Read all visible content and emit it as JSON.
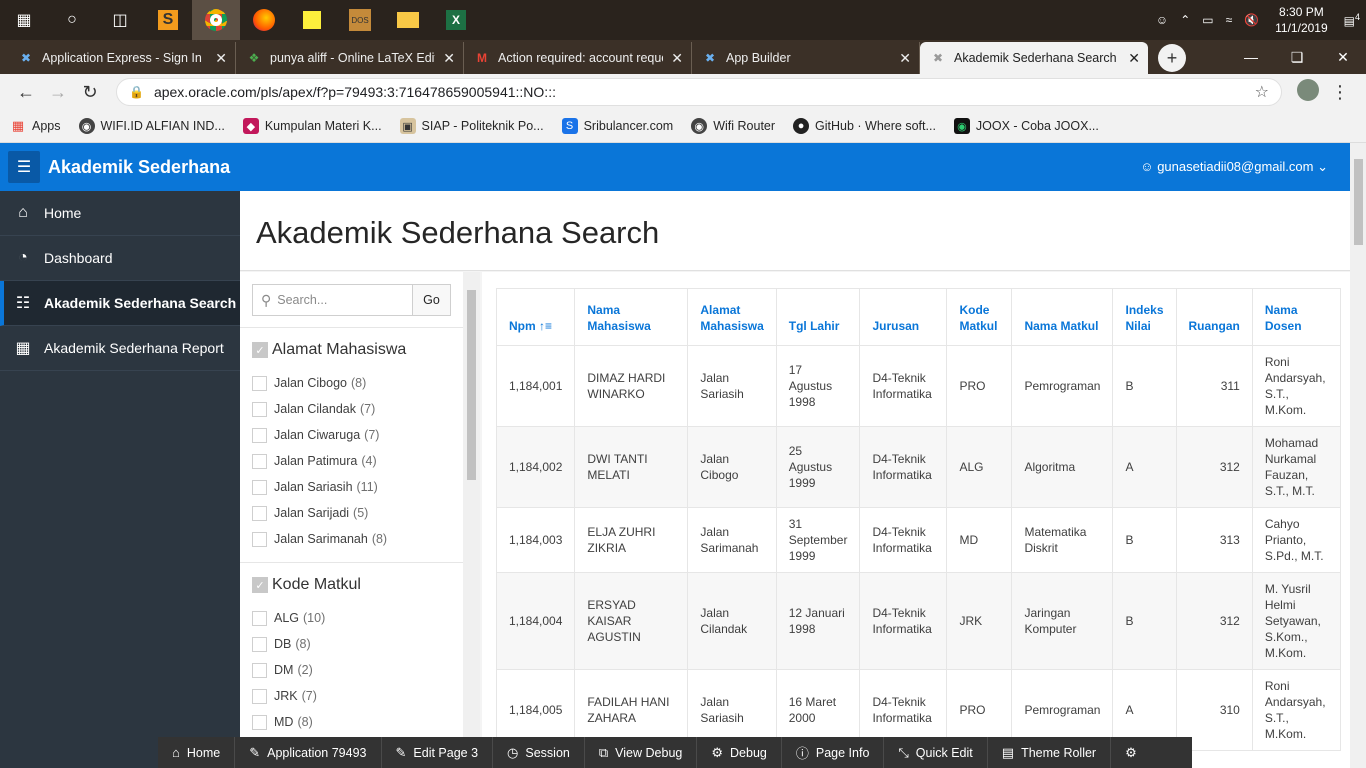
{
  "taskbar": {
    "time": "8:30 PM",
    "date": "11/1/2019",
    "notif_count": "4"
  },
  "browser": {
    "tabs": [
      {
        "title": "Application Express - Sign In",
        "icon": "apex-icon"
      },
      {
        "title": "punya aliff - Online LaTeX Editor",
        "icon": "overleaf-icon"
      },
      {
        "title": "Action required: account request",
        "icon": "gmail-icon"
      },
      {
        "title": "App Builder",
        "icon": "apex-icon"
      },
      {
        "title": "Akademik Sederhana Search",
        "icon": "apex-icon"
      }
    ],
    "url": "apex.oracle.com/pls/apex/f?p=79493:3:716478659005941::NO:::",
    "bookmarks": [
      "Apps",
      "WIFI.ID ALFIAN IND...",
      "Kumpulan Materi K...",
      "SIAP - Politeknik Po...",
      "Sribulancer.com",
      "Wifi Router",
      "GitHub · Where soft...",
      "JOOX - Coba JOOX..."
    ]
  },
  "app": {
    "name": "Akademik Sederhana",
    "user": "gunasetiadii08@gmail.com"
  },
  "nav": [
    {
      "label": "Home"
    },
    {
      "label": "Dashboard"
    },
    {
      "label": "Akademik Sederhana Search"
    },
    {
      "label": "Akademik Sederhana Report"
    }
  ],
  "page": {
    "title": "Akademik Sederhana Search"
  },
  "search": {
    "placeholder": "Search...",
    "go_label": "Go"
  },
  "facets": {
    "alamat": {
      "title": "Alamat Mahasiswa",
      "items": [
        {
          "label": "Jalan Cibogo",
          "count": "(8)"
        },
        {
          "label": "Jalan Cilandak",
          "count": "(7)"
        },
        {
          "label": "Jalan Ciwaruga",
          "count": "(7)"
        },
        {
          "label": "Jalan Patimura",
          "count": "(4)"
        },
        {
          "label": "Jalan Sariasih",
          "count": "(11)"
        },
        {
          "label": "Jalan Sarijadi",
          "count": "(5)"
        },
        {
          "label": "Jalan Sarimanah",
          "count": "(8)"
        }
      ]
    },
    "kode": {
      "title": "Kode Matkul",
      "items": [
        {
          "label": "ALG",
          "count": "(10)"
        },
        {
          "label": "DB",
          "count": "(8)"
        },
        {
          "label": "DM",
          "count": "(2)"
        },
        {
          "label": "JRK",
          "count": "(7)"
        },
        {
          "label": "MD",
          "count": "(8)"
        }
      ]
    }
  },
  "table": {
    "headers": [
      "Npm",
      "Nama Mahasiswa",
      "Alamat Mahasiswa",
      "Tgl Lahir",
      "Jurusan",
      "Kode Matkul",
      "Nama Matkul",
      "Indeks Nilai",
      "Ruangan",
      "Nama Dosen"
    ],
    "rows": [
      [
        "1,184,001",
        "DIMAZ HARDI WINARKO",
        "Jalan Sariasih",
        "17 Agustus 1998",
        "D4-Teknik Informatika",
        "PRO",
        "Pemrograman",
        "B",
        "311",
        "Roni Andarsyah, S.T., M.Kom."
      ],
      [
        "1,184,002",
        "DWI TANTI MELATI",
        "Jalan Cibogo",
        "25 Agustus 1999",
        "D4-Teknik Informatika",
        "ALG",
        "Algoritma",
        "A",
        "312",
        "Mohamad Nurkamal Fauzan, S.T., M.T."
      ],
      [
        "1,184,003",
        "ELJA ZUHRI ZIKRIA",
        "Jalan Sarimanah",
        "31 September 1999",
        "D4-Teknik Informatika",
        "MD",
        "Matematika Diskrit",
        "B",
        "313",
        "Cahyo Prianto, S.Pd., M.T."
      ],
      [
        "1,184,004",
        "ERSYAD KAISAR AGUSTIN",
        "Jalan Cilandak",
        "12 Januari 1998",
        "D4-Teknik Informatika",
        "JRK",
        "Jaringan Komputer",
        "B",
        "312",
        "M. Yusril Helmi Setyawan, S.Kom., M.Kom."
      ],
      [
        "1,184,005",
        "FADILAH HANI ZAHARA",
        "Jalan Sariasih",
        "16 Maret 2000",
        "D4-Teknik Informatika",
        "PRO",
        "Pemrograman",
        "A",
        "310",
        "Roni Andarsyah, S.T., M.Kom."
      ]
    ]
  },
  "devbar": [
    "Home",
    "Application 79493",
    "Edit Page 3",
    "Session",
    "View Debug",
    "Debug",
    "Page Info",
    "Quick Edit",
    "Theme Roller"
  ]
}
